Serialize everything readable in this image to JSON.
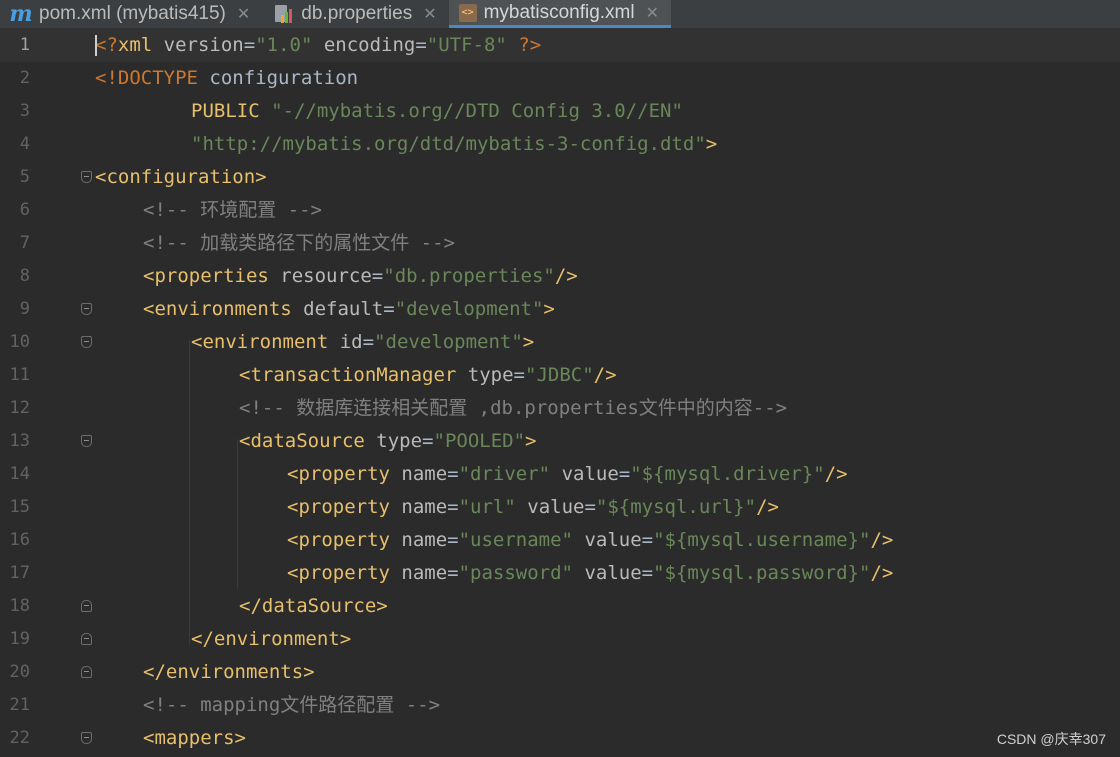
{
  "tabs": [
    {
      "label": "pom.xml (mybatis415)",
      "icon": "maven-icon",
      "active": false
    },
    {
      "label": "db.properties",
      "icon": "properties-file-icon",
      "active": false
    },
    {
      "label": "mybatisconfig.xml",
      "icon": "xml-file-icon",
      "active": true
    }
  ],
  "editor": {
    "current_line": 1,
    "lines": [
      {
        "n": "1",
        "tokens": [
          [
            "decl",
            "<?"
          ],
          [
            "tag",
            "xml"
          ],
          [
            "attr",
            " version"
          ],
          [
            "plain",
            "="
          ],
          [
            "val",
            "\"1.0\""
          ],
          [
            "attr",
            " encoding"
          ],
          [
            "plain",
            "="
          ],
          [
            "val",
            "\"UTF-8\""
          ],
          [
            "decl",
            " ?>"
          ]
        ]
      },
      {
        "n": "2",
        "tokens": [
          [
            "decl",
            "<!DOCTYPE "
          ],
          [
            "plain",
            "configuration"
          ]
        ]
      },
      {
        "n": "3",
        "tokens": [
          [
            "tag",
            "PUBLIC "
          ],
          [
            "val",
            "\"-//mybatis.org//DTD Config 3.0//EN\""
          ]
        ]
      },
      {
        "n": "4",
        "tokens": [
          [
            "val",
            "\"http://mybatis.org/dtd/mybatis-3-config.dtd\""
          ],
          [
            "tag",
            ">"
          ]
        ]
      },
      {
        "n": "5",
        "tokens": [
          [
            "tag",
            "<configuration>"
          ]
        ]
      },
      {
        "n": "6",
        "tokens": [
          [
            "cmt",
            "<!-- 环境配置 -->"
          ]
        ]
      },
      {
        "n": "7",
        "tokens": [
          [
            "cmt",
            "<!-- 加载类路径下的属性文件 -->"
          ]
        ]
      },
      {
        "n": "8",
        "tokens": [
          [
            "tag",
            "<properties"
          ],
          [
            "attr",
            " resource"
          ],
          [
            "plain",
            "="
          ],
          [
            "val",
            "\"db.properties\""
          ],
          [
            "tag",
            "/>"
          ]
        ]
      },
      {
        "n": "9",
        "tokens": [
          [
            "tag",
            "<environments"
          ],
          [
            "attr",
            " default"
          ],
          [
            "plain",
            "="
          ],
          [
            "val",
            "\"development\""
          ],
          [
            "tag",
            ">"
          ]
        ]
      },
      {
        "n": "10",
        "tokens": [
          [
            "tag",
            "<environment"
          ],
          [
            "attr",
            " id"
          ],
          [
            "plain",
            "="
          ],
          [
            "val",
            "\"development\""
          ],
          [
            "tag",
            ">"
          ]
        ]
      },
      {
        "n": "11",
        "tokens": [
          [
            "tag",
            "<transactionManager"
          ],
          [
            "attr",
            " type"
          ],
          [
            "plain",
            "="
          ],
          [
            "val",
            "\"JDBC\""
          ],
          [
            "tag",
            "/>"
          ]
        ]
      },
      {
        "n": "12",
        "tokens": [
          [
            "cmt",
            "<!-- 数据库连接相关配置 ,db.properties文件中的内容-->"
          ]
        ]
      },
      {
        "n": "13",
        "tokens": [
          [
            "tag",
            "<dataSource"
          ],
          [
            "attr",
            " type"
          ],
          [
            "plain",
            "="
          ],
          [
            "val",
            "\"POOLED\""
          ],
          [
            "tag",
            ">"
          ]
        ]
      },
      {
        "n": "14",
        "tokens": [
          [
            "tag",
            "<property"
          ],
          [
            "attr",
            " name"
          ],
          [
            "plain",
            "="
          ],
          [
            "val",
            "\"driver\""
          ],
          [
            "attr",
            " value"
          ],
          [
            "plain",
            "="
          ],
          [
            "val",
            "\"${mysql.driver}\""
          ],
          [
            "tag",
            "/>"
          ]
        ]
      },
      {
        "n": "15",
        "tokens": [
          [
            "tag",
            "<property"
          ],
          [
            "attr",
            " name"
          ],
          [
            "plain",
            "="
          ],
          [
            "val",
            "\"url\""
          ],
          [
            "attr",
            " value"
          ],
          [
            "plain",
            "="
          ],
          [
            "val",
            "\"${mysql.url}\""
          ],
          [
            "tag",
            "/>"
          ]
        ]
      },
      {
        "n": "16",
        "tokens": [
          [
            "tag",
            "<property"
          ],
          [
            "attr",
            " name"
          ],
          [
            "plain",
            "="
          ],
          [
            "val",
            "\"username\""
          ],
          [
            "attr",
            " value"
          ],
          [
            "plain",
            "="
          ],
          [
            "val",
            "\"${mysql.username}\""
          ],
          [
            "tag",
            "/>"
          ]
        ]
      },
      {
        "n": "17",
        "tokens": [
          [
            "tag",
            "<property"
          ],
          [
            "attr",
            " name"
          ],
          [
            "plain",
            "="
          ],
          [
            "val",
            "\"password\""
          ],
          [
            "attr",
            " value"
          ],
          [
            "plain",
            "="
          ],
          [
            "val",
            "\"${mysql.password}\""
          ],
          [
            "tag",
            "/>"
          ]
        ]
      },
      {
        "n": "18",
        "tokens": [
          [
            "tag",
            "</dataSource>"
          ]
        ]
      },
      {
        "n": "19",
        "tokens": [
          [
            "tag",
            "</environment>"
          ]
        ]
      },
      {
        "n": "20",
        "tokens": [
          [
            "tag",
            "</environments>"
          ]
        ]
      },
      {
        "n": "21",
        "tokens": [
          [
            "cmt",
            "<!-- mapping文件路径配置 -->"
          ]
        ]
      },
      {
        "n": "22",
        "tokens": [
          [
            "tag",
            "<mappers>"
          ]
        ]
      }
    ]
  },
  "colors": {
    "tag": "#e8bf6a",
    "attr": "#bababa",
    "value": "#6a8759",
    "comment": "#808080",
    "background": "#2b2b2b",
    "tab_accent": "#4a88c7"
  },
  "watermark": "CSDN @庆幸307"
}
